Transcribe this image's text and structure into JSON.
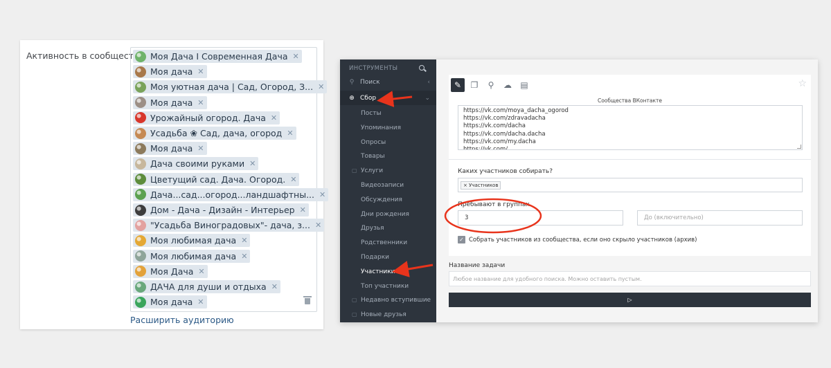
{
  "left_panel": {
    "label": "Активность в сообществах:",
    "tags": [
      {
        "text": "Моя Дача I Современная Дача",
        "color": "#6fb36a"
      },
      {
        "text": "Моя дача",
        "color": "#a8784a"
      },
      {
        "text": "Моя уютная дача | Сад, Огород, З...",
        "color": "#7aa35b"
      },
      {
        "text": "Моя дача",
        "color": "#9c8f86"
      },
      {
        "text": "Урожайный огород. Дача",
        "color": "#d8362b"
      },
      {
        "text": "Усадьба ❀ Сад, дача, огород",
        "color": "#c58a54"
      },
      {
        "text": "Моя дача",
        "color": "#8c7a5c"
      },
      {
        "text": "Дача своими руками",
        "color": "#c7b79c"
      },
      {
        "text": "Цветущий сад. Дача. Огород.",
        "color": "#5d8c3c"
      },
      {
        "text": "Дача...сад...огород...ландшафтны...",
        "color": "#5ca150"
      },
      {
        "text": "Дом - Дача - Дизайн - Интерьер",
        "color": "#3d3d3d"
      },
      {
        "text": "\"Усадьба Виноградовых\"- дача, з...",
        "color": "#e3a2a0"
      },
      {
        "text": "Моя любимая дача",
        "color": "#e4a835"
      },
      {
        "text": "Моя любимая дача",
        "color": "#8fa59a"
      },
      {
        "text": "Моя Дача",
        "color": "#e3a23a"
      },
      {
        "text": "ДАЧА для души и отдыха",
        "color": "#6aa87c"
      },
      {
        "text": "Моя дача",
        "color": "#3aa55c"
      }
    ],
    "remove_glyph": "✕",
    "expand_link": "Расширить аудиторию"
  },
  "sidebar": {
    "header": "ИНСТРУМЕНТЫ",
    "items": [
      {
        "label": "Поиск",
        "icon": "search-icon",
        "glyph": "⚲",
        "chevron": "‹"
      },
      {
        "label": "Сбор",
        "icon": "search-plus-icon",
        "glyph": "⊕",
        "chevron": "⌄"
      }
    ],
    "subitems": [
      {
        "label": "Посты",
        "locked": false
      },
      {
        "label": "Упоминания",
        "locked": false
      },
      {
        "label": "Опросы",
        "locked": false
      },
      {
        "label": "Товары",
        "locked": false
      },
      {
        "label": "Услуги",
        "locked": true
      },
      {
        "label": "Видеозаписи",
        "locked": false
      },
      {
        "label": "Обсуждения",
        "locked": false
      },
      {
        "label": "Дни рождения",
        "locked": false
      },
      {
        "label": "Друзья",
        "locked": false
      },
      {
        "label": "Родственники",
        "locked": false
      },
      {
        "label": "Подарки",
        "locked": false
      },
      {
        "label": "Участники",
        "locked": false
      },
      {
        "label": "Топ участники",
        "locked": false
      },
      {
        "label": "Недавно вступившие",
        "locked": true
      },
      {
        "label": "Новые друзья",
        "locked": true
      }
    ],
    "lock_glyph": "🔒"
  },
  "main": {
    "toolbar": [
      {
        "name": "edit-icon",
        "glyph": "✎"
      },
      {
        "name": "copy-icon",
        "glyph": "❐"
      },
      {
        "name": "location-icon",
        "glyph": "⚲"
      },
      {
        "name": "upload-cloud-icon",
        "glyph": "☁"
      },
      {
        "name": "book-icon",
        "glyph": "▤"
      }
    ],
    "star_glyph": "☆",
    "section_title": "Сообщества ВКонтакте",
    "urls": [
      "https://vk.com/moya_dacha_ogorod",
      "https://vk.com/zdravadacha",
      "https://vk.com/dacha",
      "https://vk.com/dacha.dacha",
      "https://vk.com/my.dacha",
      "https://vk.com/..."
    ],
    "which_members_label": "Каких участников собирать?",
    "chip_label": "× Участников",
    "groups_label": "Пребывают в группах",
    "groups_from_value": "3",
    "groups_to_placeholder": "До (включительно)",
    "checkbox_label": "Собрать участников из сообщества, если оно скрыло участников (архив)",
    "checkbox_checked": true,
    "check_glyph": "✓"
  },
  "task": {
    "label": "Название задачи",
    "placeholder": "Любое название для удобного поиска. Можно оставить пустым.",
    "run_glyph": "▷"
  },
  "colors": {
    "annotation_red": "#e8341c",
    "sidebar_bg": "#2d343d",
    "tag_bg": "#dfe6ed",
    "link": "#2a5885"
  }
}
